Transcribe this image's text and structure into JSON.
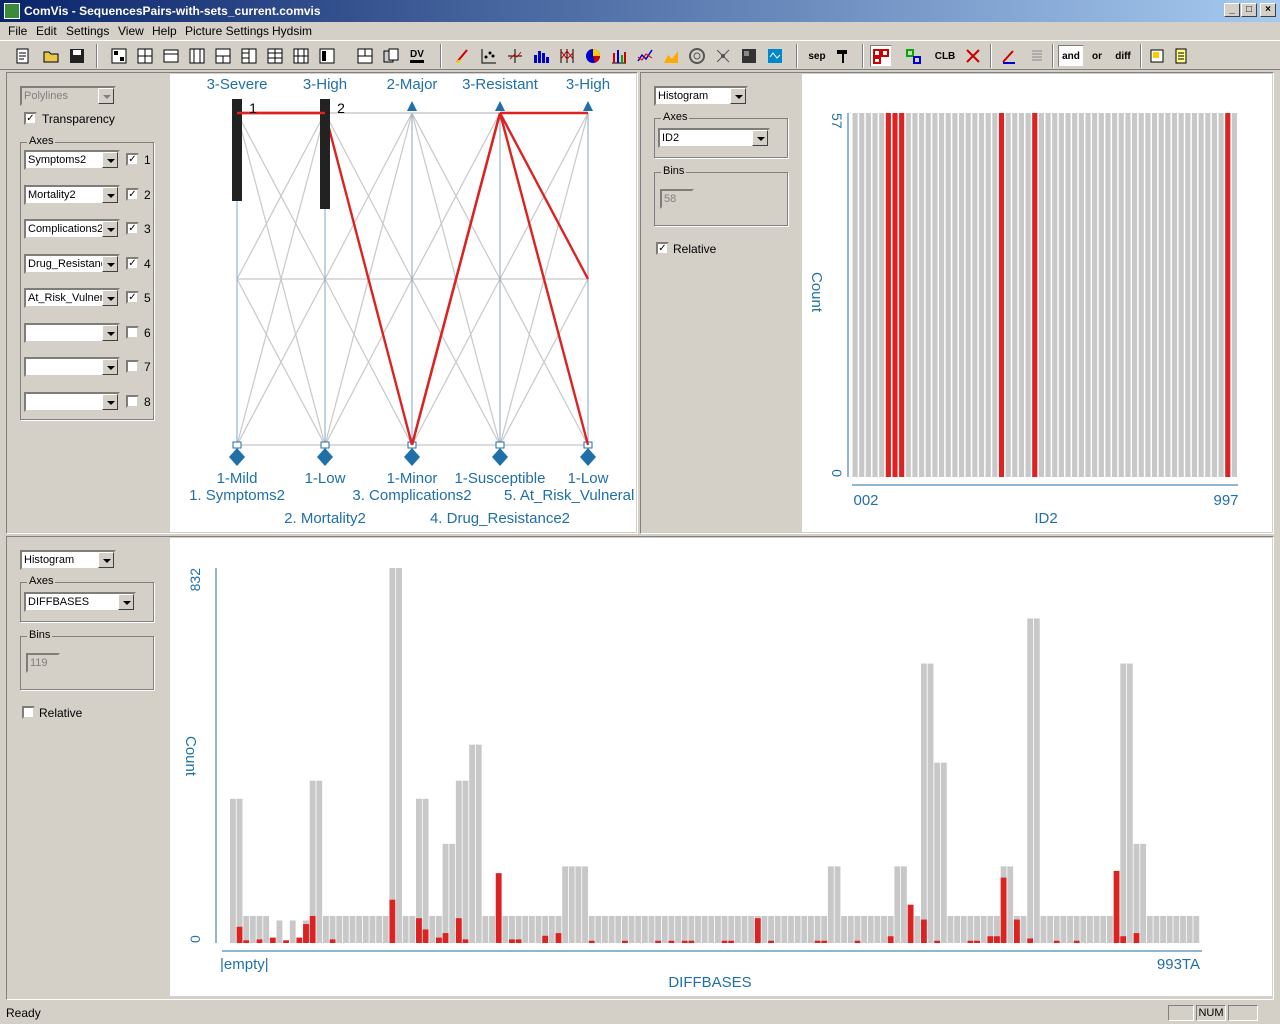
{
  "window": {
    "title": "ComVis - SequencesPairs-with-sets_current.comvis",
    "minimize": "_",
    "maximize": "□",
    "close": "×"
  },
  "menu": [
    "File",
    "Edit",
    "Settings",
    "View",
    "Help",
    "Picture Settings",
    "Hydsim"
  ],
  "toolbar": {
    "sep_label": "sep",
    "clb_label": "CLB",
    "and_label": "and",
    "or_label": "or",
    "diff_label": "diff",
    "dv_label": "DV"
  },
  "parallel": {
    "view_type": "Polylines",
    "transparency_label": "Transparency",
    "axes_label": "Axes",
    "axes": [
      {
        "value": "Symptoms2",
        "checked": true,
        "num": "1"
      },
      {
        "value": "Mortality2",
        "checked": true,
        "num": "2"
      },
      {
        "value": "Complications2",
        "checked": true,
        "num": "3"
      },
      {
        "value": "Drug_Resistance2",
        "checked": true,
        "num": "4"
      },
      {
        "value": "At_Risk_Vulnerable2",
        "checked": true,
        "num": "5"
      },
      {
        "value": "",
        "checked": false,
        "num": "6"
      },
      {
        "value": "",
        "checked": false,
        "num": "7"
      },
      {
        "value": "",
        "checked": false,
        "num": "8"
      }
    ],
    "top_labels": [
      "3-Severe",
      "3-High",
      "2-Major",
      "3-Resistant",
      "3-High"
    ],
    "bottom_labels": [
      "1-Mild",
      "1-Low",
      "1-Minor",
      "1-Susceptible",
      "1-Low"
    ],
    "axis_names": [
      "1. Symptoms2",
      "2. Mortality2",
      "3. Complications2",
      "4. Drug_Resistance2",
      "5. At_Risk_Vulneral"
    ],
    "brush_marks": [
      "1",
      "2"
    ],
    "highlight": [
      [
        0,
        0
      ],
      [
        1,
        0
      ],
      [
        2,
        1
      ],
      [
        3,
        0
      ],
      [
        4,
        0.5
      ],
      [
        4,
        1
      ]
    ]
  },
  "hist1": {
    "view_type": "Histogram",
    "axes_label": "Axes",
    "axis": "ID2",
    "bins_label": "Bins",
    "bins": "58",
    "relative_label": "Relative",
    "relative": true,
    "chart_data": {
      "type": "bar",
      "xlabel": "ID2",
      "ylabel": "Count",
      "ylim": [
        0,
        57
      ],
      "y_ticks": [
        "57",
        "0"
      ],
      "x_ticks": [
        "002",
        "997"
      ],
      "bins": 58,
      "values_all": 57,
      "highlighted_bins": [
        6,
        7,
        8,
        23,
        28,
        57
      ]
    }
  },
  "hist2": {
    "view_type": "Histogram",
    "axes_label": "Axes",
    "axis": "DIFFBASES",
    "bins_label": "Bins",
    "bins": "119",
    "relative_label": "Relative",
    "relative": false,
    "chart_data": {
      "type": "bar",
      "xlabel": "DIFFBASES",
      "ylabel": "Count",
      "ylim": [
        0,
        832
      ],
      "y_ticks": [
        "832",
        "0"
      ],
      "x_ticks": [
        "|empty|",
        "993TA"
      ],
      "gray": [
        320,
        320,
        60,
        60,
        60,
        60,
        0,
        50,
        0,
        50,
        0,
        50,
        360,
        360,
        60,
        60,
        60,
        60,
        60,
        60,
        60,
        60,
        60,
        60,
        832,
        832,
        60,
        60,
        320,
        320,
        60,
        60,
        220,
        220,
        360,
        360,
        440,
        440,
        60,
        60,
        60,
        60,
        60,
        60,
        60,
        60,
        60,
        60,
        60,
        60,
        170,
        170,
        170,
        170,
        60,
        60,
        60,
        60,
        60,
        60,
        60,
        60,
        60,
        60,
        60,
        60,
        60,
        60,
        60,
        60,
        60,
        60,
        60,
        60,
        60,
        60,
        60,
        60,
        60,
        60,
        60,
        60,
        60,
        60,
        60,
        60,
        60,
        60,
        60,
        60,
        170,
        170,
        60,
        60,
        60,
        60,
        60,
        60,
        60,
        60,
        170,
        170,
        60,
        60,
        620,
        620,
        400,
        400,
        60,
        60,
        60,
        60,
        60,
        60,
        60,
        60,
        170,
        170,
        60,
        60,
        720,
        720,
        60,
        60,
        60,
        60,
        60,
        60,
        60,
        60,
        60,
        60,
        60,
        60,
        620,
        620,
        220,
        220,
        60,
        60,
        60,
        60,
        60,
        60,
        60,
        60
      ],
      "red": [
        0,
        36,
        6,
        0,
        8,
        0,
        12,
        0,
        6,
        0,
        12,
        42,
        60,
        0,
        0,
        8,
        0,
        0,
        0,
        0,
        0,
        0,
        0,
        0,
        96,
        0,
        0,
        0,
        55,
        30,
        0,
        12,
        22,
        0,
        55,
        8,
        0,
        0,
        0,
        0,
        155,
        0,
        8,
        8,
        0,
        0,
        0,
        16,
        0,
        22,
        0,
        0,
        0,
        0,
        5,
        0,
        0,
        0,
        0,
        5,
        0,
        0,
        0,
        0,
        5,
        0,
        5,
        0,
        5,
        5,
        0,
        0,
        0,
        0,
        5,
        5,
        0,
        0,
        0,
        55,
        0,
        5,
        0,
        0,
        0,
        0,
        0,
        0,
        5,
        5,
        0,
        0,
        0,
        0,
        5,
        0,
        0,
        0,
        0,
        15,
        0,
        0,
        85,
        0,
        52,
        0,
        5,
        0,
        0,
        0,
        0,
        5,
        5,
        0,
        15,
        15,
        145,
        0,
        52,
        0,
        10,
        0,
        0,
        0,
        5,
        0,
        0,
        5,
        0,
        0,
        0,
        0,
        0,
        160,
        15,
        0,
        22,
        0,
        0,
        0,
        0,
        0,
        0,
        0,
        0,
        0
      ]
    }
  },
  "status": {
    "text": "Ready",
    "num": "NUM"
  }
}
